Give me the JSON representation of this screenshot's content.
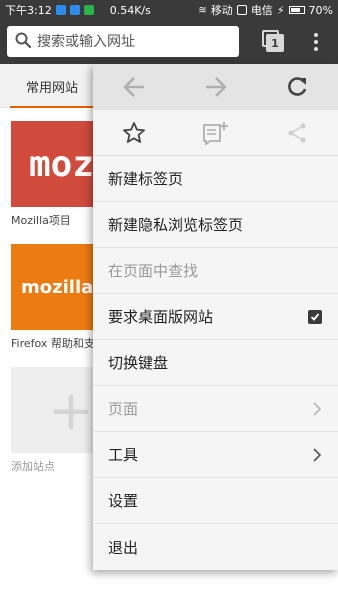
{
  "status_bar": {
    "time": "下午3:12",
    "speed": "0.54K/s",
    "carrier1": "移动",
    "carrier2": "电信",
    "battery": "70%"
  },
  "toolbar": {
    "search_placeholder": "搜索或输入网址",
    "tab_count": "1"
  },
  "home": {
    "tab_label": "常用网站",
    "tiles": [
      {
        "logo_text": "mozilla",
        "label": "Mozilla项目"
      },
      {
        "logo_text": "mozillasupport",
        "label": "Firefox 帮助和支持"
      },
      {
        "logo_text": "+",
        "label": "添加站点"
      }
    ]
  },
  "menu": {
    "items": [
      {
        "label": "新建标签页",
        "enabled": true
      },
      {
        "label": "新建隐私浏览标签页",
        "enabled": true
      },
      {
        "label": "在页面中查找",
        "enabled": false
      },
      {
        "label": "要求桌面版网站",
        "enabled": true,
        "checked": true
      },
      {
        "label": "切换键盘",
        "enabled": true
      },
      {
        "label": "页面",
        "enabled": false,
        "submenu": true
      },
      {
        "label": "工具",
        "enabled": true,
        "submenu": true
      },
      {
        "label": "设置",
        "enabled": true
      },
      {
        "label": "退出",
        "enabled": true
      }
    ]
  },
  "colors": {
    "toolbar_bg": "#3a3a3a",
    "accent": "#e66000",
    "mozilla_tile": "#d14b3d",
    "support_tile": "#ec7b12"
  }
}
